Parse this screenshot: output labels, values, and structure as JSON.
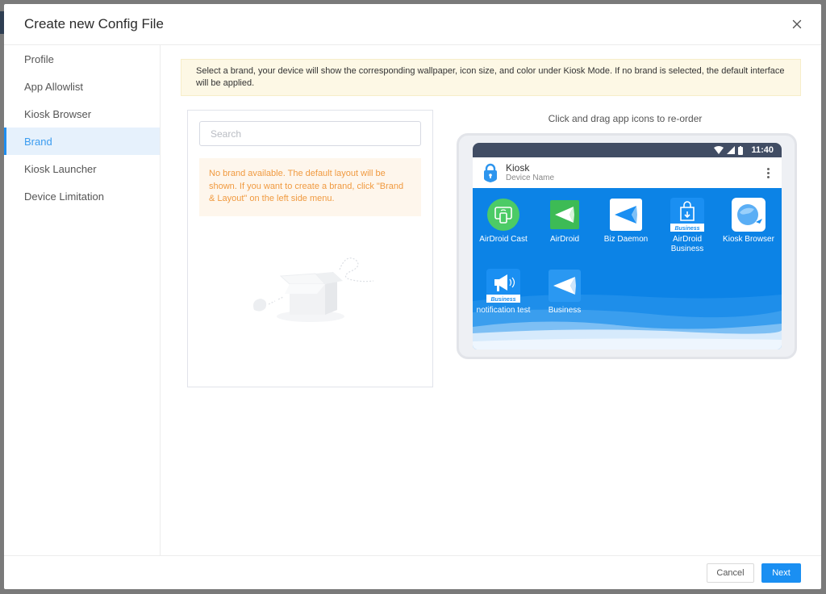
{
  "modal": {
    "title": "Create new Config File",
    "close_icon": "close-icon"
  },
  "sidebar": {
    "items": [
      {
        "label": "Profile",
        "active": false
      },
      {
        "label": "App Allowlist",
        "active": false
      },
      {
        "label": "Kiosk Browser",
        "active": false
      },
      {
        "label": "Brand",
        "active": true
      },
      {
        "label": "Kiosk Launcher",
        "active": false
      },
      {
        "label": "Device Limitation",
        "active": false
      }
    ]
  },
  "notice": {
    "text": "Select a brand, your device will show the corresponding wallpaper, icon size, and color under Kiosk Mode. If no brand is selected, the default interface will be applied."
  },
  "brand_panel": {
    "search_placeholder": "Search",
    "search_value": "",
    "warning": "No brand available. The default layout will be shown. If you want to create a brand, click \"Brand & Layout\" on the left side menu.",
    "illustration": "empty-box-icon"
  },
  "preview": {
    "caption": "Click and drag app icons to re-order",
    "status_bar": {
      "time": "11:40",
      "icons": [
        "wifi-icon",
        "signal-icon",
        "battery-icon"
      ]
    },
    "app_bar": {
      "title": "Kiosk",
      "subtitle": "Device Name",
      "icon": "lock-icon",
      "menu_icon": "more-vertical-icon"
    },
    "apps": [
      {
        "label": "AirDroid Cast",
        "icon": "airdroid-cast-icon"
      },
      {
        "label": "AirDroid",
        "icon": "airdroid-icon"
      },
      {
        "label": "Biz Daemon",
        "icon": "biz-daemon-icon"
      },
      {
        "label": "AirDroid Business",
        "icon": "airdroid-business-icon",
        "badge": "Business"
      },
      {
        "label": "Kiosk Browser",
        "icon": "kiosk-browser-icon"
      },
      {
        "label": "notification test",
        "icon": "notification-icon",
        "badge": "Business"
      },
      {
        "label": "Business",
        "icon": "business-icon"
      }
    ]
  },
  "footer": {
    "cancel_label": "Cancel",
    "next_label": "Next"
  },
  "colors": {
    "accent": "#1a8ff2",
    "sidebar_active_bg": "#e6f1fc",
    "notice_bg": "#fdf8e5",
    "warning_text": "#f09a40",
    "wallpaper": "#0c83e6",
    "status_bar": "#414d64"
  }
}
